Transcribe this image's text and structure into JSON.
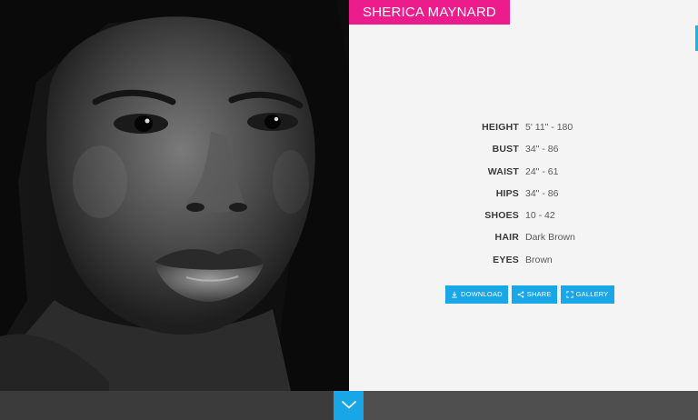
{
  "model": {
    "name": "SHERICA MAYNARD"
  },
  "stats": [
    {
      "label": "HEIGHT",
      "value": "5' 11\" - 180"
    },
    {
      "label": "BUST",
      "value": "34\" - 86"
    },
    {
      "label": "WAIST",
      "value": "24\" - 61"
    },
    {
      "label": "HIPS",
      "value": "34\" - 86"
    },
    {
      "label": "SHOES",
      "value": "10 - 42"
    },
    {
      "label": "HAIR",
      "value": "Dark Brown"
    },
    {
      "label": "EYES",
      "value": "Brown"
    }
  ],
  "actions": {
    "download_label": "DOWNLOAD",
    "share_label": "SHARE",
    "gallery_label": "GALLERY"
  },
  "colors": {
    "accent_pink": "#ec1c8c",
    "accent_blue": "#1aa7e8",
    "bottom_bar": "#4f4f4f"
  },
  "icons": {
    "download": "download-icon",
    "share": "share-icon",
    "gallery": "expand-icon",
    "scroll": "chevron-down-icon"
  }
}
